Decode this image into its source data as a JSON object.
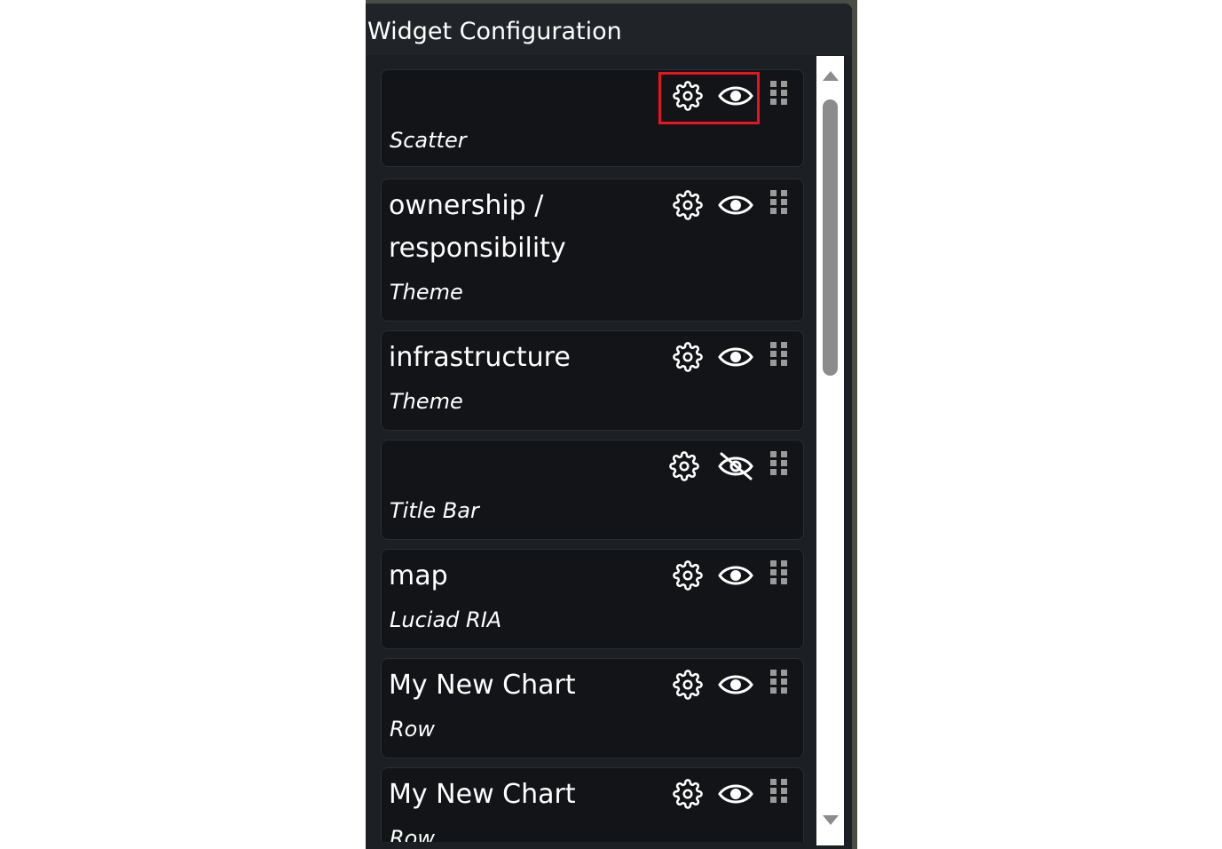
{
  "panel": {
    "title": "Widget Configuration"
  },
  "widgets": [
    {
      "title": "",
      "subtitle": "Scatter",
      "visible": true,
      "highlighted": true
    },
    {
      "title": "ownership / responsibility",
      "subtitle": "Theme",
      "visible": true
    },
    {
      "title": "infrastructure",
      "subtitle": "Theme",
      "visible": true
    },
    {
      "title": "",
      "subtitle": "Title Bar",
      "visible": false
    },
    {
      "title": "map",
      "subtitle": "Luciad RIA",
      "visible": true
    },
    {
      "title": "My New Chart",
      "subtitle": "Row",
      "visible": true
    },
    {
      "title": "My New Chart",
      "subtitle": "Row",
      "visible": true
    }
  ],
  "icons": {
    "settings": "gear-icon",
    "visible": "eye-icon",
    "hidden": "eye-slash-icon",
    "drag": "drag-handle-icon"
  },
  "colors": {
    "panel_bg": "#1c1f23",
    "card_bg": "#131417",
    "highlight": "#e8151f",
    "scrollbar_thumb": "#8c8c8c"
  }
}
